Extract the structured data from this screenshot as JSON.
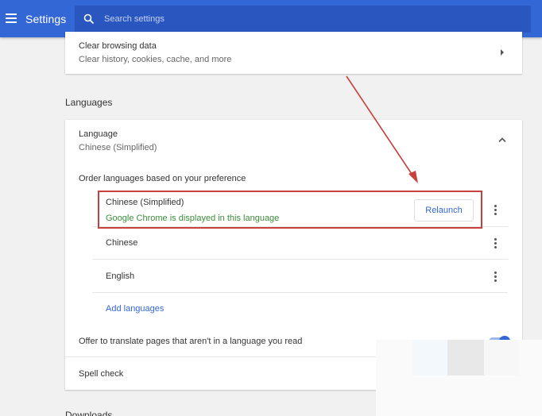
{
  "header": {
    "title": "Settings",
    "search_placeholder": "Search settings",
    "menu_icon": "hamburger-menu-icon",
    "search_icon": "search-icon"
  },
  "clear_browsing": {
    "title": "Clear browsing data",
    "subtitle": "Clear history, cookies, cache, and more"
  },
  "languages_section": {
    "heading": "Languages",
    "language_label": "Language",
    "language_value": "Chinese (Simplified)",
    "order_label": "Order languages based on your preference",
    "items": [
      {
        "name": "Chinese (Simplified)",
        "note": "Google Chrome is displayed in this language",
        "action": "Relaunch"
      },
      {
        "name": "Chinese"
      },
      {
        "name": "English"
      }
    ],
    "add_languages": "Add languages",
    "translate_offer": "Offer to translate pages that aren't in a language you read",
    "translate_enabled": true,
    "spell_check": "Spell check"
  },
  "next_section_heading": "Downloads",
  "colors": {
    "header_bg": "#3367d6",
    "link": "#3367d6",
    "note_green": "#3a8d3a",
    "annotation_red": "#c9403a"
  }
}
